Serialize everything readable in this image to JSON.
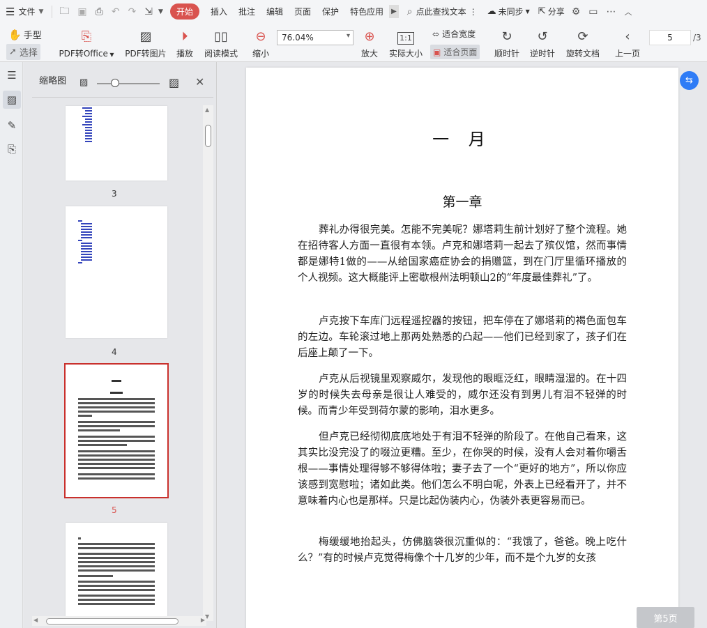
{
  "menu": {
    "file": "文件",
    "tabs": [
      "开始",
      "插入",
      "批注",
      "编辑",
      "页面",
      "保护",
      "特色应用"
    ],
    "search": "点此查找文本",
    "sync": "未同步",
    "share": "分享"
  },
  "toolbar": {
    "hand": "手型",
    "select": "选择",
    "pdf_to_office": "PDF转Office",
    "pdf_to_image": "PDF转图片",
    "play": "播放",
    "read_mode": "阅读模式",
    "zoom_out": "缩小",
    "zoom_value": "76.04%",
    "zoom_in": "放大",
    "actual_size": "实际大小",
    "fit_width": "适合宽度",
    "fit_page": "适合页面",
    "rotate_cw": "顺时针",
    "rotate_ccw": "逆时针",
    "rotate_doc": "旋转文档",
    "prev_page": "上一页",
    "current_page": "5",
    "total_pages": "/3"
  },
  "thumbnails": {
    "title": "缩略图",
    "pages": [
      {
        "num": "3",
        "selected": false
      },
      {
        "num": "4",
        "selected": false
      },
      {
        "num": "5",
        "selected": true
      }
    ]
  },
  "document": {
    "title": "一 月",
    "chapter": "第一章",
    "paragraphs": [
      "葬礼办得很完美。怎能不完美呢？娜塔莉生前计划好了整个流程。她在招待客人方面一直很有本领。卢克和娜塔莉一起去了殡仪馆，然而事情都是娜特1做的——从给国家癌症协会的捐赠篮，到在门厅里循环播放的个人视频。这大概能评上密歇根州法明顿山2的“年度最佳葬礼”了。",
      "卢克按下车库门远程遥控器的按钮，把车停在了娜塔莉的褐色面包车的左边。车轮滚过地上那两处熟悉的凸起——他们已经到家了，孩子们在后座上颠了一下。",
      "卢克从后视镜里观察威尔，发现他的眼眶泛红，眼睛湿湿的。在十四岁的时候失去母亲是很让人难受的，威尔还没有到男儿有泪不轻弹的时候。而青少年受到荷尔蒙的影响，泪水更多。",
      "但卢克已经彻彻底底地处于有泪不轻弹的阶段了。在他自己看来，这其实比没完没了的啜泣更糟。至少，在你哭的时候，没有人会对着你嚼舌根——事情处理得够不够得体啦；妻子去了一个“更好的地方”，所以你应该感到宽慰啦；诸如此类。他们怎么不明白呢，外表上已经看开了，并不意味着内心也是那样。只是比起伪装内心，伪装外表更容易而已。",
      "梅缓缓地抬起头，仿佛脑袋很沉重似的：“我饿了，爸爸。晚上吃什么？”有的时候卢克觉得梅像个十几岁的少年，而不是个九岁的女孩"
    ]
  },
  "status": {
    "page_badge": "第5页"
  }
}
